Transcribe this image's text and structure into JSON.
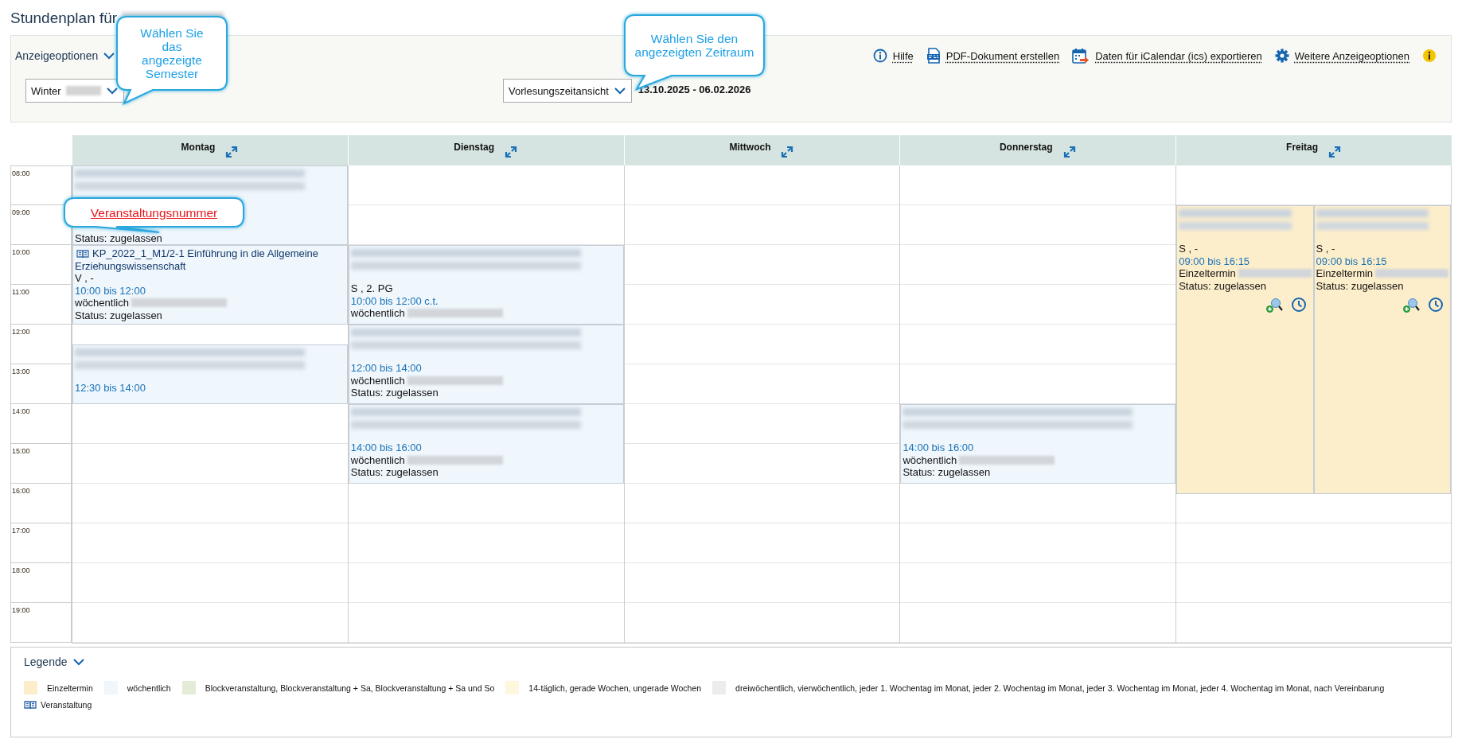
{
  "page": {
    "title": "Stundenplan für"
  },
  "options": {
    "heading": "Anzeigeoptionen",
    "semester_select": {
      "value": "Winter"
    },
    "period_select": {
      "value": "Vorlesungszeitansicht"
    },
    "date_range": "13.10.2025 - 06.02.2026",
    "links": [
      {
        "kind": "help",
        "label": "Hilfe"
      },
      {
        "kind": "pdf",
        "label": "PDF-Dokument erstellen"
      },
      {
        "kind": "ics",
        "label": "Daten für iCalendar (ics) exportieren"
      },
      {
        "kind": "settings",
        "label": "Weitere Anzeigeoptionen"
      }
    ]
  },
  "callouts": [
    {
      "kind": "plain",
      "text": "Wählen Sie das angezeigte Semester"
    },
    {
      "kind": "plain",
      "text": "Wählen Sie den angezeigten Zeitraum"
    },
    {
      "kind": "link",
      "text": "Veranstaltungsnummer"
    }
  ],
  "calendar": {
    "hours": [
      "08:00",
      "09:00",
      "10:00",
      "11:00",
      "12:00",
      "13:00",
      "14:00",
      "15:00",
      "16:00",
      "17:00",
      "18:00",
      "19:00"
    ],
    "days": [
      {
        "name": "Montag",
        "events": [
          {
            "color": "#eff6fc",
            "actions": false,
            "lines": [
              {
                "kind": "blurred"
              },
              {
                "kind": "status",
                "text": "Status: zugelassen"
              }
            ]
          },
          {
            "color": "#eff6fc",
            "actions": false,
            "title": "KP_2022_1_M1/2-1 Einführung in die Allgemeine Erziehungswissenschaft",
            "lines": [
              {
                "kind": "text",
                "text": "V , -"
              },
              {
                "kind": "time",
                "text": "10:00 bis 12:00"
              },
              {
                "kind": "recurrence",
                "text": "wöchentlich"
              },
              {
                "kind": "status",
                "text": "Status: zugelassen"
              }
            ]
          },
          {
            "color": "#eff6fc",
            "actions": false,
            "lines": [
              {
                "kind": "time",
                "text": "12:30 bis 14:00"
              }
            ]
          }
        ]
      },
      {
        "name": "Dienstag",
        "events": [
          {
            "color": "#eff6fc",
            "actions": false,
            "lines": [
              {
                "kind": "text",
                "text": "S , 2. PG"
              },
              {
                "kind": "time",
                "text": "10:00 bis 12:00 c.t."
              },
              {
                "kind": "recurrence",
                "text": "wöchentlich"
              }
            ]
          },
          {
            "color": "#eff6fc",
            "actions": false,
            "lines": [
              {
                "kind": "time",
                "text": "12:00 bis 14:00"
              },
              {
                "kind": "recurrence",
                "text": "wöchentlich"
              },
              {
                "kind": "status",
                "text": "Status: zugelassen"
              }
            ]
          },
          {
            "color": "#eff6fc",
            "actions": false,
            "lines": [
              {
                "kind": "time",
                "text": "14:00 bis 16:00"
              },
              {
                "kind": "recurrence",
                "text": "wöchentlich"
              },
              {
                "kind": "status",
                "text": "Status: zugelassen"
              }
            ]
          }
        ]
      },
      {
        "name": "Mittwoch"
      },
      {
        "name": "Donnerstag",
        "events": [
          {
            "color": "#eff6fc",
            "actions": false,
            "lines": [
              {
                "kind": "time",
                "text": "14:00 bis 16:00"
              },
              {
                "kind": "recurrence",
                "text": "wöchentlich"
              },
              {
                "kind": "status",
                "text": "Status: zugelassen"
              }
            ]
          }
        ]
      },
      {
        "name": "Freitag",
        "events": [
          {
            "color": "#fdeecb",
            "actions": true,
            "lines": [
              {
                "kind": "text",
                "text": "S , -"
              },
              {
                "kind": "time",
                "text": "09:00 bis 16:15"
              },
              {
                "kind": "recurrence",
                "text": "Einzeltermin"
              },
              {
                "kind": "status",
                "text": "Status: zugelassen"
              }
            ]
          },
          {
            "color": "#fdeecb",
            "actions": true,
            "lines": [
              {
                "kind": "text",
                "text": "S , -"
              },
              {
                "kind": "time",
                "text": "09:00 bis 16:15"
              },
              {
                "kind": "recurrence",
                "text": "Einzeltermin"
              },
              {
                "kind": "status",
                "text": "Status: zugelassen"
              }
            ]
          }
        ]
      }
    ]
  },
  "legend": {
    "title": "Legende",
    "items": [
      {
        "label": "Einzeltermin",
        "color": "#fdeecb"
      },
      {
        "label": "wöchentlich",
        "color": "#eff6fc"
      },
      {
        "label": "Blockveranstaltung, Blockveranstaltung + Sa, Blockveranstaltung + Sa und So",
        "color": "#e3ecd6"
      },
      {
        "label": "14-täglich, gerade Wochen, ungerade Wochen",
        "color": "#fdf8dd"
      },
      {
        "label": "dreiwöchentlich, vierwöchentlich, jeder 1. Wochentag im Monat, jeder 2. Wochentag im Monat, jeder 3. Wochentag im Monat, jeder 4. Wochentag im Monat, nach Vereinbarung",
        "color": "#ececec"
      }
    ],
    "symbols": [
      {
        "label": "Veranstaltung"
      }
    ]
  }
}
